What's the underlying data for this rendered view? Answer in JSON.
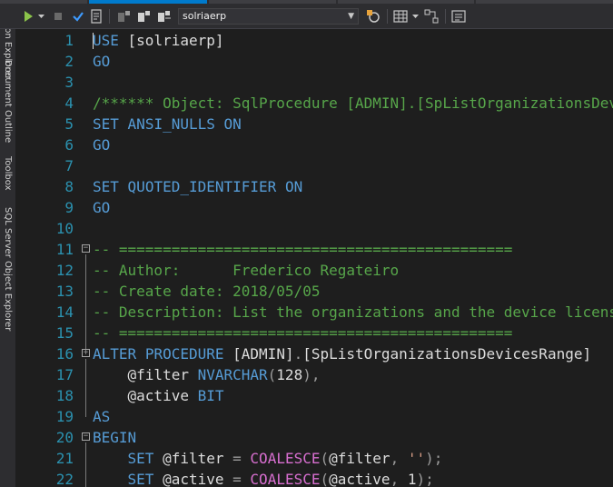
{
  "toolbar": {
    "database": "solriaerp"
  },
  "sidebar": {
    "labels": [
      "Solution Explorer",
      "Document Outline",
      "Toolbox",
      "SQL Server Object Explorer"
    ]
  },
  "colors": {
    "keyword": "#569cd6",
    "comment": "#57a64a",
    "string": "#d69d85",
    "function": "#d86fd0",
    "line_number": "#2b91af",
    "editor_background": "#1e1e1e"
  },
  "editor": {
    "lines": [
      {
        "n": "1",
        "tokens": [
          {
            "t": "USE",
            "c": "kw"
          },
          {
            "t": " [solriaerp]",
            "c": "pl"
          }
        ]
      },
      {
        "n": "2",
        "tokens": [
          {
            "t": "GO",
            "c": "kw"
          }
        ]
      },
      {
        "n": "3",
        "tokens": []
      },
      {
        "n": "4",
        "tokens": [
          {
            "t": "/****** Object: SqlProcedure [ADMIN].[SpListOrganizationsDevicesRange]",
            "c": "cm"
          }
        ]
      },
      {
        "n": "5",
        "tokens": [
          {
            "t": "SET",
            "c": "kw"
          },
          {
            "t": " ",
            "c": "pl"
          },
          {
            "t": "ANSI_NULLS",
            "c": "kw"
          },
          {
            "t": " ",
            "c": "pl"
          },
          {
            "t": "ON",
            "c": "kw"
          }
        ]
      },
      {
        "n": "6",
        "tokens": [
          {
            "t": "GO",
            "c": "kw"
          }
        ]
      },
      {
        "n": "7",
        "tokens": []
      },
      {
        "n": "8",
        "tokens": [
          {
            "t": "SET",
            "c": "kw"
          },
          {
            "t": " ",
            "c": "pl"
          },
          {
            "t": "QUOTED_IDENTIFIER",
            "c": "kw"
          },
          {
            "t": " ",
            "c": "pl"
          },
          {
            "t": "ON",
            "c": "kw"
          }
        ]
      },
      {
        "n": "9",
        "tokens": [
          {
            "t": "GO",
            "c": "kw"
          }
        ]
      },
      {
        "n": "10",
        "tokens": []
      },
      {
        "n": "11",
        "fold": true,
        "tokens": [
          {
            "t": "-- =============================================",
            "c": "cm"
          }
        ]
      },
      {
        "n": "12",
        "tokens": [
          {
            "t": "-- Author:      Frederico Regateiro",
            "c": "cm"
          }
        ]
      },
      {
        "n": "13",
        "tokens": [
          {
            "t": "-- Create date: 2018/05/05",
            "c": "cm"
          }
        ]
      },
      {
        "n": "14",
        "tokens": [
          {
            "t": "-- Description: List the organizations and the device licenses",
            "c": "cm"
          }
        ]
      },
      {
        "n": "15",
        "tokens": [
          {
            "t": "-- =============================================",
            "c": "cm"
          }
        ]
      },
      {
        "n": "16",
        "fold": true,
        "tokens": [
          {
            "t": "ALTER",
            "c": "kw"
          },
          {
            "t": " ",
            "c": "pl"
          },
          {
            "t": "PROCEDURE",
            "c": "kw"
          },
          {
            "t": " [ADMIN]",
            "c": "pl"
          },
          {
            "t": ".",
            "c": "op"
          },
          {
            "t": "[SpListOrganizationsDevicesRange]",
            "c": "pl"
          }
        ]
      },
      {
        "n": "17",
        "tokens": [
          {
            "t": "    @filter ",
            "c": "pl"
          },
          {
            "t": "NVARCHAR",
            "c": "kw"
          },
          {
            "t": "(",
            "c": "op"
          },
          {
            "t": "128",
            "c": "pl"
          },
          {
            "t": "),",
            "c": "op"
          }
        ]
      },
      {
        "n": "18",
        "tokens": [
          {
            "t": "    @active ",
            "c": "pl"
          },
          {
            "t": "BIT",
            "c": "kw"
          }
        ]
      },
      {
        "n": "19",
        "tokens": [
          {
            "t": "AS",
            "c": "kw"
          }
        ]
      },
      {
        "n": "20",
        "fold": true,
        "tokens": [
          {
            "t": "BEGIN",
            "c": "kw"
          }
        ]
      },
      {
        "n": "21",
        "tokens": [
          {
            "t": "    ",
            "c": "pl"
          },
          {
            "t": "SET",
            "c": "kw"
          },
          {
            "t": " @filter ",
            "c": "pl"
          },
          {
            "t": "=",
            "c": "op"
          },
          {
            "t": " ",
            "c": "pl"
          },
          {
            "t": "COALESCE",
            "c": "fn"
          },
          {
            "t": "(",
            "c": "op"
          },
          {
            "t": "@filter",
            "c": "pl"
          },
          {
            "t": ",",
            "c": "op"
          },
          {
            "t": " ",
            "c": "pl"
          },
          {
            "t": "''",
            "c": "st"
          },
          {
            "t": ");",
            "c": "op"
          }
        ]
      },
      {
        "n": "22",
        "tokens": [
          {
            "t": "    ",
            "c": "pl"
          },
          {
            "t": "SET",
            "c": "kw"
          },
          {
            "t": " @active ",
            "c": "pl"
          },
          {
            "t": "=",
            "c": "op"
          },
          {
            "t": " ",
            "c": "pl"
          },
          {
            "t": "COALESCE",
            "c": "fn"
          },
          {
            "t": "(",
            "c": "op"
          },
          {
            "t": "@active",
            "c": "pl"
          },
          {
            "t": ",",
            "c": "op"
          },
          {
            "t": " 1",
            "c": "pl"
          },
          {
            "t": ");",
            "c": "op"
          }
        ]
      }
    ]
  }
}
